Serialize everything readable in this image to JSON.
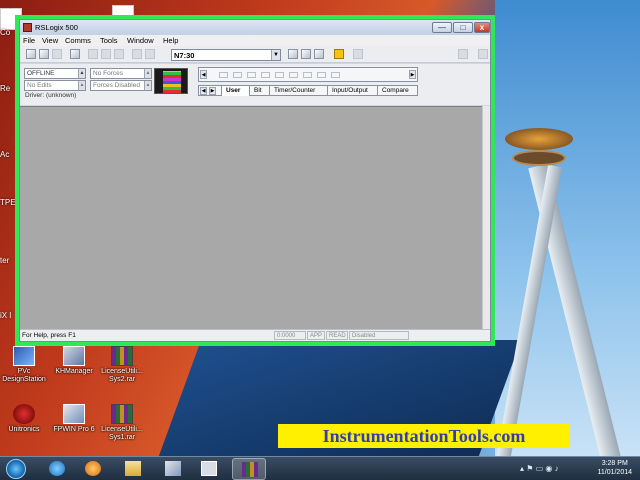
{
  "window": {
    "title": "RSLogix 500",
    "minimize": "—",
    "maximize": "□",
    "close": "x"
  },
  "menu": [
    "File",
    "View",
    "Comms",
    "Tools",
    "Window",
    "Help"
  ],
  "toolbar": {
    "address_value": "N7:30",
    "icons": [
      "new-icon",
      "open-icon",
      "save-icon",
      "print-icon",
      "cut-icon",
      "copy-icon",
      "paste-icon",
      "undo-icon",
      "redo-icon",
      "zoom-in-icon",
      "zoom-out-icon",
      "fit-icon",
      "add-rung-icon",
      "back-icon",
      "forward-icon"
    ]
  },
  "status": {
    "mode": "OFFLINE",
    "forces": "No Forces",
    "edits": "No Edits",
    "forces_state": "Forces Disabled",
    "driver": "Driver: (unknown)"
  },
  "instruction_tabs": [
    "User",
    "Bit",
    "Timer/Counter",
    "Input/Output",
    "Compare"
  ],
  "statusbar": {
    "help": "For Help, press F1",
    "address": "0:0000",
    "app": "APP",
    "read": "READ",
    "state": "Disabled"
  },
  "desktop_icons": [
    {
      "label": "PVc DesignStation",
      "icon": "pvc-icon"
    },
    {
      "label": "KHManager",
      "icon": "khmanager-icon"
    },
    {
      "label": "LicenseUtili... Sys2.rar",
      "icon": "rar-icon"
    },
    {
      "label": "Unitronics",
      "icon": "unitronics-icon"
    },
    {
      "label": "FPWIN Pro 6",
      "icon": "fpwin-icon"
    },
    {
      "label": "LicenseUtili... Sys1.rar",
      "icon": "rar-icon"
    }
  ],
  "desktop_edge_labels": [
    "Co",
    "Re",
    "Ac",
    "TPE",
    "ter",
    "iX l"
  ],
  "watermark": "InstrumentationTools.com",
  "taskbar": {
    "time": "3:28 PM",
    "date": "11/01/2014",
    "apps": [
      "ie-icon",
      "media-player-icon",
      "explorer-icon",
      "app-icon",
      "window-icon",
      "winrar-icon"
    ]
  }
}
